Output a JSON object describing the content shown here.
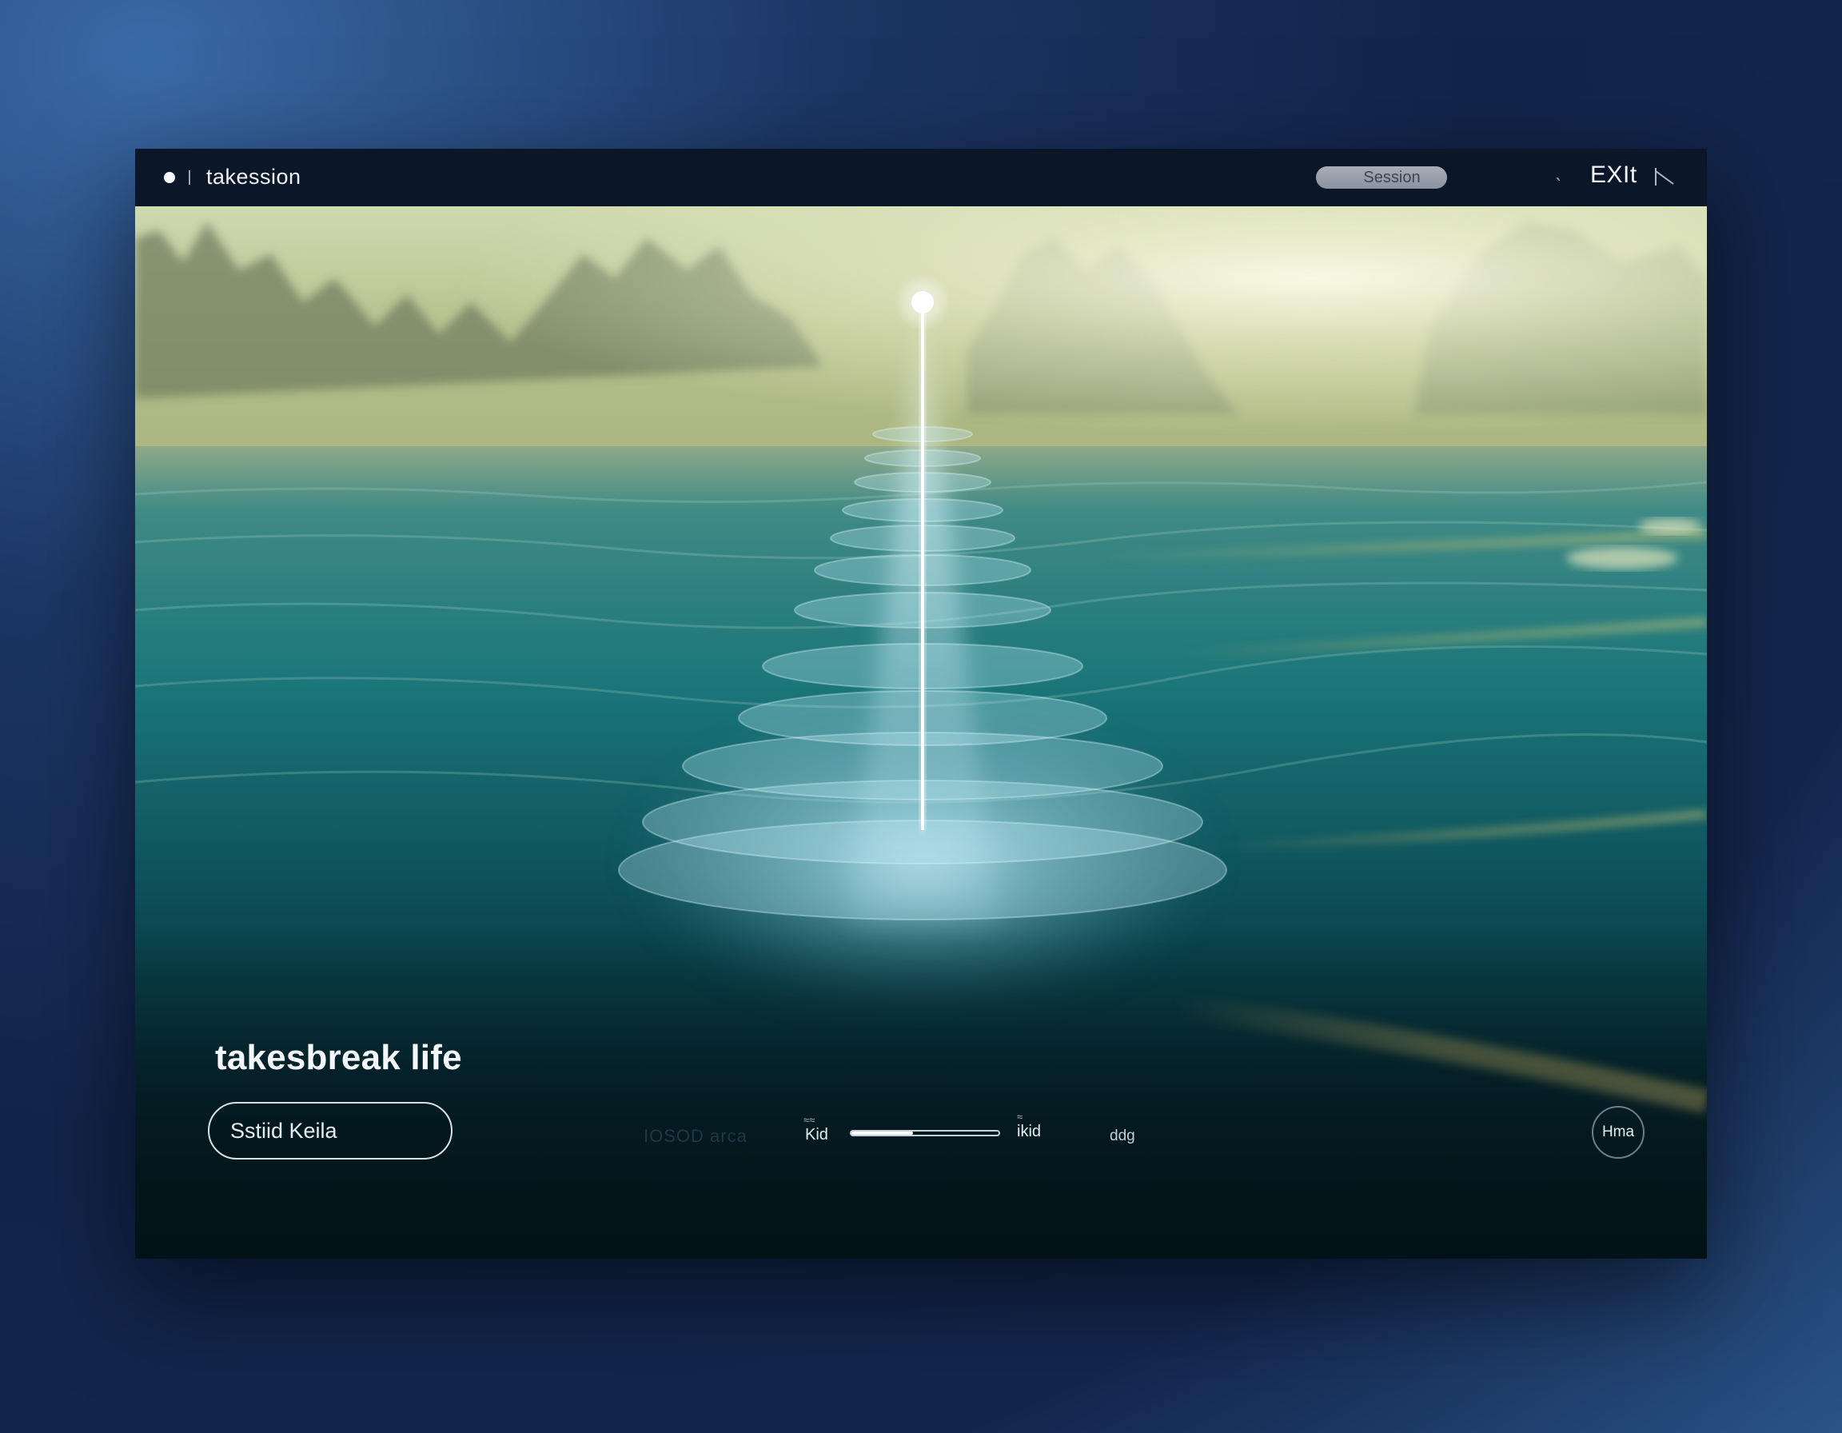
{
  "titlebar": {
    "app_name": "takession",
    "session_pill": "Session",
    "exit_label": "EXIt"
  },
  "hero": {
    "title": "takesbreak life",
    "action_button": "Sstiid  Keila"
  },
  "player": {
    "faint_label": "IOSOD  arca",
    "left_label": "Kid",
    "right_label": "ikid",
    "end_label": "ddg",
    "progress": 0.42
  },
  "circle_button": "Hma",
  "icons": {
    "status": "dot-icon",
    "back": "arrow-icon",
    "exit": "exit-icon"
  },
  "colors": {
    "frame_bg": "#13264d",
    "titlebar": "#0b1628",
    "water": "#0f5a63",
    "mist": "#e8ecc6"
  }
}
